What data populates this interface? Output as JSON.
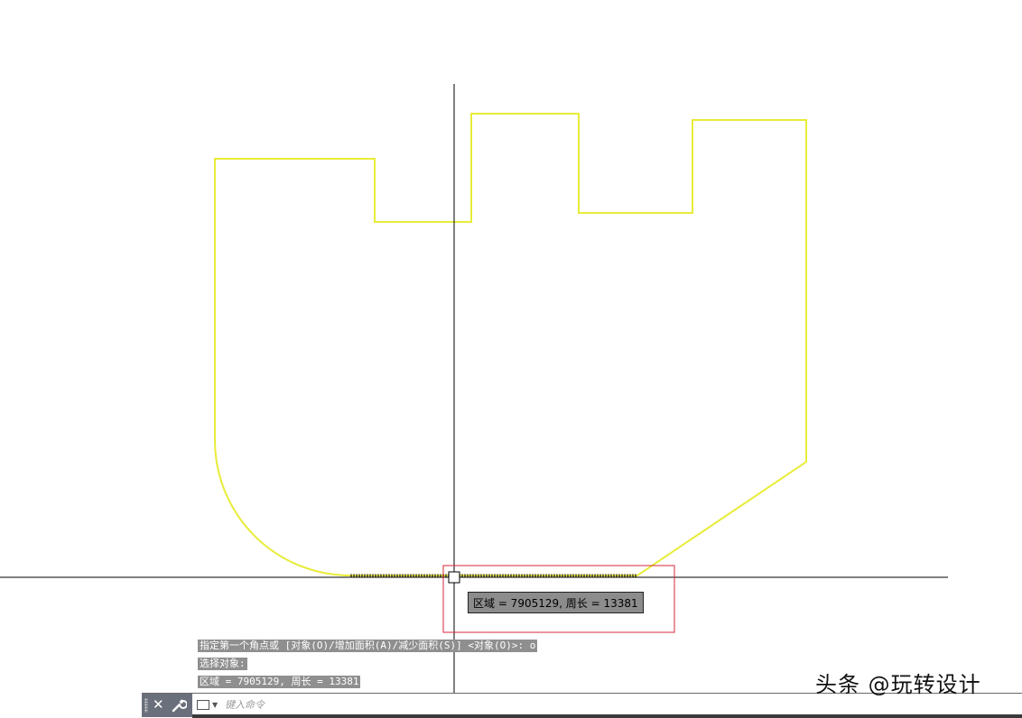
{
  "tooltip": {
    "text": "区域 = 7905129, 周长 = 13381"
  },
  "command_history": [
    "指定第一个角点或 [对象(O)/增加面积(A)/减少面积(S)] <对象(O)>: o",
    "选择对象:",
    "区域 = 7905129, 周长 = 13381"
  ],
  "command_line": {
    "placeholder": "键入命令",
    "close_label": "✕"
  },
  "watermark": {
    "text": "头条 @玩转设计"
  },
  "colors": {
    "outline": "#e8ec38",
    "highlight_edge": "#6e6a2e",
    "crosshair": "#000000",
    "selection_box": "#d7243c",
    "tooltip_bg": "#8c8c8c",
    "history_bg": "#8f8f8f",
    "cmd_grip_bg": "#6a6f7c"
  },
  "icons": {
    "close": "close-icon",
    "customize": "wrench-icon",
    "recent_commands": "command-prompt-icon"
  }
}
